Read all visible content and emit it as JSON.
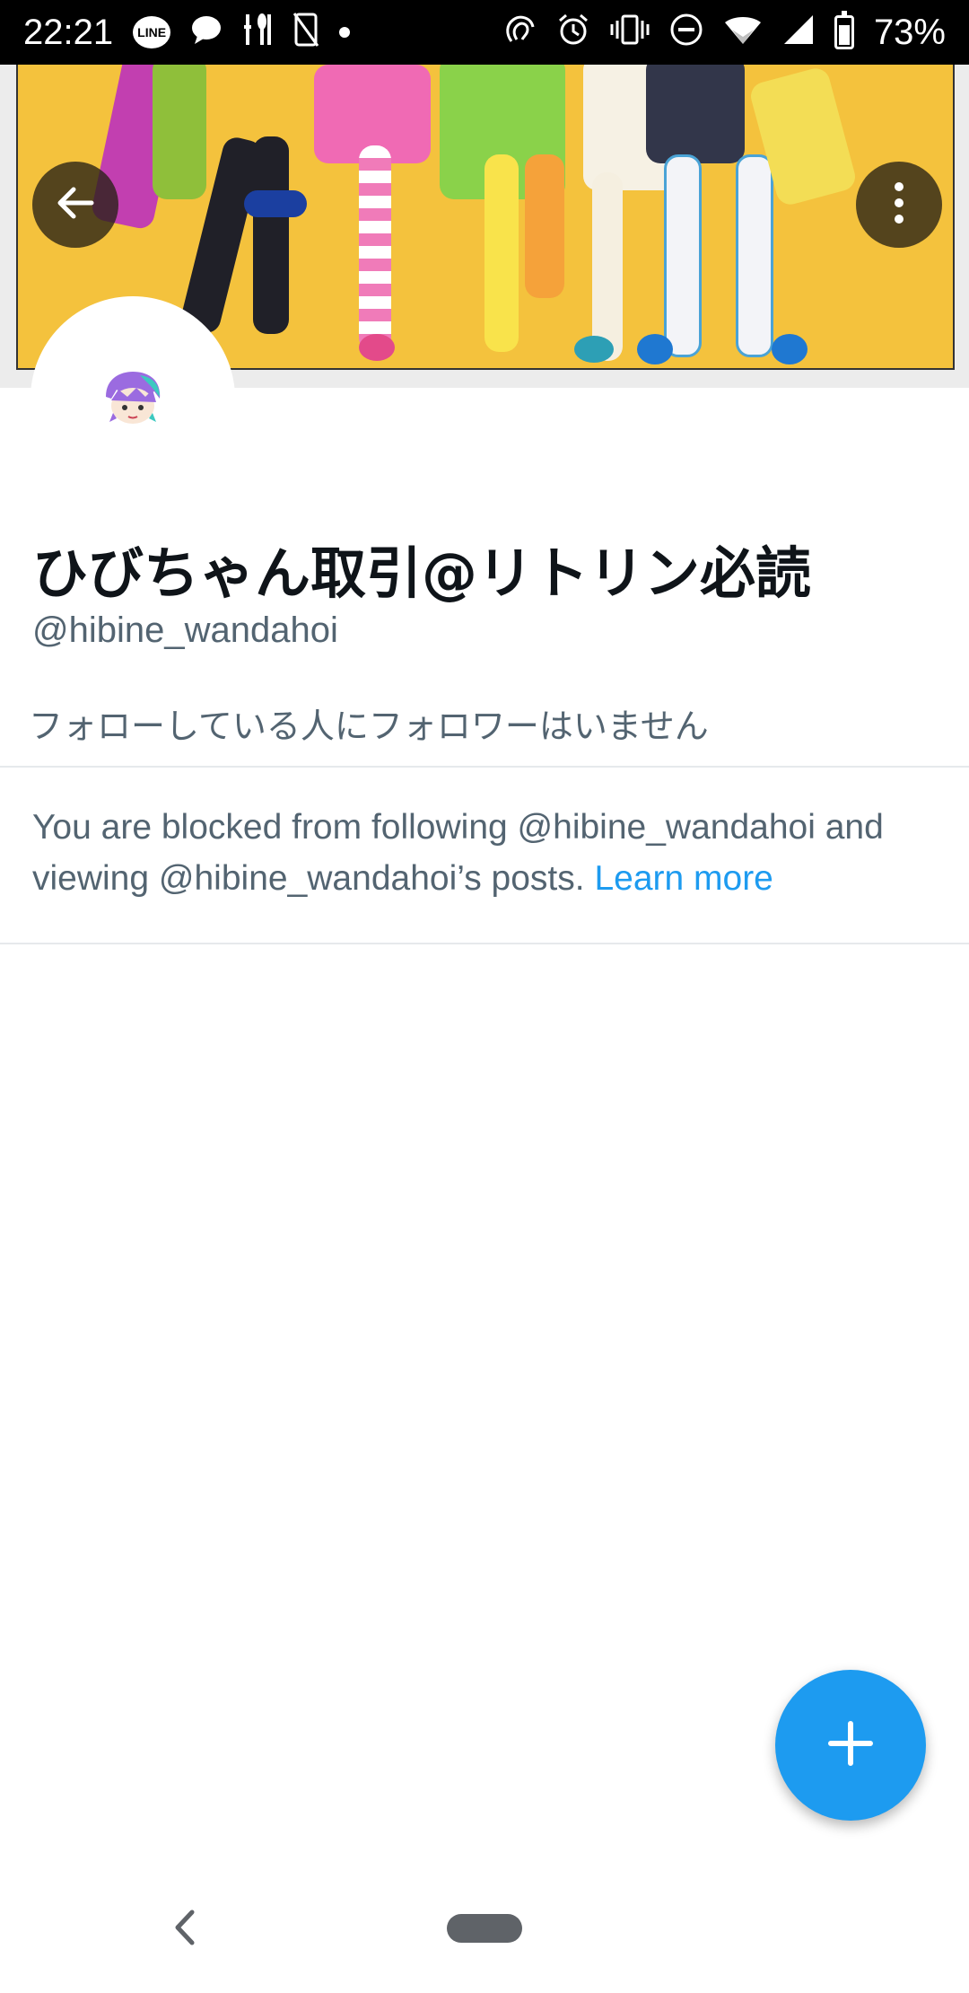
{
  "status_bar": {
    "time": "22:21",
    "notification_icons": [
      "line-icon",
      "chat-bubble-icon",
      "restaurant-icon",
      "no-phone-icon",
      "dot-icon"
    ],
    "system_icons": [
      "nfc-icon",
      "alarm-icon",
      "vibrate-icon",
      "do-not-disturb-icon",
      "wifi-icon",
      "signal-icon",
      "battery-icon"
    ],
    "line_badge": "LINE",
    "battery_percent": "73%"
  },
  "profile": {
    "display_name": "ひびちゃん取引@リトリン必読",
    "handle": "@hibine_wandahoi",
    "followers_you_know": "フォローしている人にフォロワーはいません"
  },
  "blocked_notice": {
    "message": "You are blocked from following @hibine_wandahoi and viewing @hibine_wandahoi’s posts.",
    "link_label": "Learn more"
  },
  "colors": {
    "accent": "#1d9bf0",
    "secondary_text": "#536471",
    "primary_text": "#0f1419",
    "banner_background": "#f4c23d"
  },
  "icons": {
    "back": "back-arrow-icon",
    "more": "more-vertical-icon",
    "fab": "plus-icon",
    "nav_back": "chevron-left-icon",
    "nav_home": "home-pill-icon"
  }
}
